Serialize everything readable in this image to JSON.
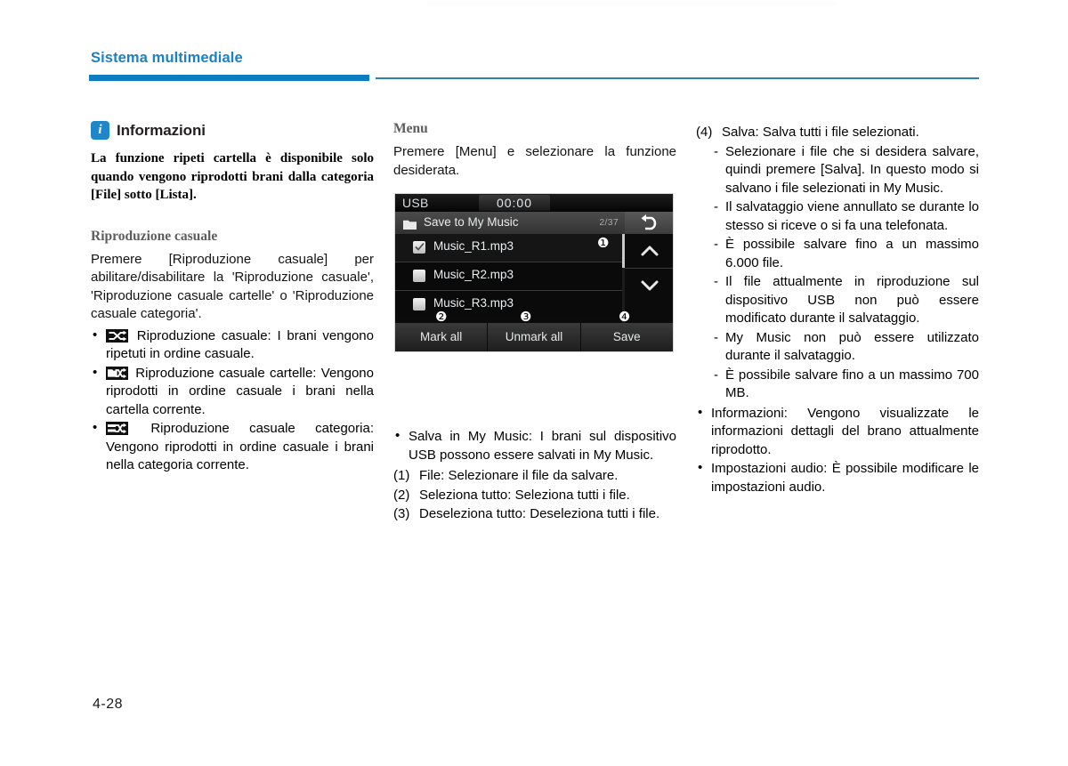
{
  "header": {
    "chapter_title": "Sistema multimediale",
    "watermark": "",
    "rule_color": "#0a7ec0"
  },
  "footer": {
    "page_number": "4-28"
  },
  "column1": {
    "info_box": {
      "icon": "info-icon",
      "icon_letter": "i",
      "title": "Informazioni",
      "body": "La funzione ripeti cartella è disponibile solo quando vengono riprodotti brani dalla categoria [File] sotto [Lista]."
    },
    "section_heading": "Riproduzione casuale",
    "section_body": "Premere [Riproduzione casuale] per abilitare/disabilitare la 'Riproduzione casuale', 'Riproduzione casuale cartelle' o 'Riproduzione casuale categoria'.",
    "bullets": [
      {
        "icon": "shuffle-icon",
        "text": "Riproduzione casuale: I brani vengono ripetuti in ordine casuale."
      },
      {
        "icon": "shuffle-folder-icon",
        "text": "Riproduzione casuale cartelle: Vengono riprodotti in ordine casuale i brani nella cartella corrente."
      },
      {
        "icon": "shuffle-category-icon",
        "text": "Riproduzione casuale categoria: Vengono riprodotti in ordine casuale i brani nella categoria corrente."
      }
    ]
  },
  "column2": {
    "section_heading": "Menu",
    "section_body": "Premere [Menu] e selezionare la funzione desiderata.",
    "screen": {
      "source_label": "USB",
      "clock": "00:00",
      "path_label": "Save to My Music",
      "path_count": "2/37",
      "back_icon": "back-arrow-icon",
      "folder_icon": "folder-icon",
      "up_icon": "chevron-up-icon",
      "down_icon": "chevron-down-icon",
      "rows": [
        {
          "label": "Music_R1.mp3",
          "checked": true
        },
        {
          "label": "Music_R2.mp3",
          "checked": false
        },
        {
          "label": "Music_R3.mp3",
          "checked": false
        }
      ],
      "softkeys": [
        "Mark all",
        "Unmark all",
        "Save"
      ],
      "callouts": [
        "❶",
        "❷",
        "❸",
        "❹"
      ]
    },
    "bullets": [
      "Salva in My Music: I brani sul dispositivo USB possono essere salvati in My Music."
    ],
    "numbered": [
      {
        "num": "(1)",
        "text": "File: Selezionare il file da salvare."
      },
      {
        "num": "(2)",
        "text": "Seleziona tutto: Seleziona tutti i file."
      },
      {
        "num": "(3)",
        "text": "Deseleziona tutto: Deseleziona tutti i file."
      }
    ]
  },
  "column3": {
    "numbered": [
      {
        "num": "(4)",
        "text": "Salva: Salva tutti i file selezionati."
      }
    ],
    "dashes_group1": [
      "Selezionare i file che si desidera salvare, quindi premere [Salva]. In questo modo si salvano i file selezionati in My Music.",
      "Il salvataggio viene annullato se durante lo stesso si riceve o si fa una telefonata.",
      "È possibile salvare fino a un massimo 6.000 file.",
      "Il file attualmente in riproduzione sul dispositivo USB non può essere modificato durante il salvataggio.",
      "My Music non può essere utilizzato durante il salvataggio.",
      "È possibile salvare fino a un massimo 700 MB."
    ],
    "bullets": [
      "Informazioni: Vengono visualizzate le informazioni dettagli del brano attualmente riprodotto.",
      "Impostazioni audio: È possibile modificare le impostazioni audio."
    ]
  }
}
